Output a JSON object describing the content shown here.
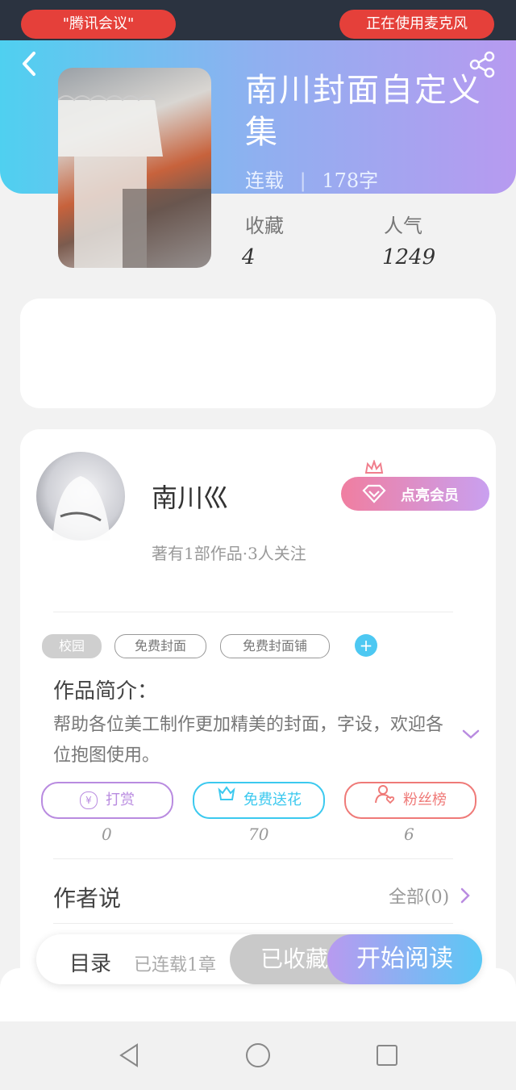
{
  "status_bar": {
    "left_pill": "\"腾讯会议\"",
    "right_pill": "正在使用麦克风"
  },
  "work": {
    "title": "南川封面自定义集",
    "status": "连载",
    "separator": "|",
    "word_count": "178字",
    "stats": [
      {
        "label": "收藏",
        "value": "4"
      },
      {
        "label": "人气",
        "value": "1249"
      }
    ]
  },
  "author": {
    "name": "南川巛",
    "meta": "著有1部作品·3人关注",
    "vip_button": "点亮会员"
  },
  "tags": [
    "校园",
    "免费封面",
    "免费封面铺"
  ],
  "intro": {
    "title": "作品简介：",
    "text": "帮助各位美工制作更加精美的封面，字设，欢迎各位抱图使用。"
  },
  "actions": [
    {
      "label": "打赏",
      "count": "0",
      "color": "#b98be0"
    },
    {
      "label": "免费送花",
      "count": "70",
      "color": "#3cc9ef"
    },
    {
      "label": "粉丝榜",
      "count": "6",
      "color": "#ef7a78"
    }
  ],
  "author_says": {
    "title": "作者说",
    "link": "全部(0)"
  },
  "bottom_bar": {
    "toc": "目录",
    "toc_sub": "已连载1章",
    "favorite": "已收藏",
    "read": "开始阅读"
  },
  "colors": {
    "header_start": "#4fd0f0",
    "header_end": "#b79af0",
    "accent_blue": "#4dc8f2"
  }
}
